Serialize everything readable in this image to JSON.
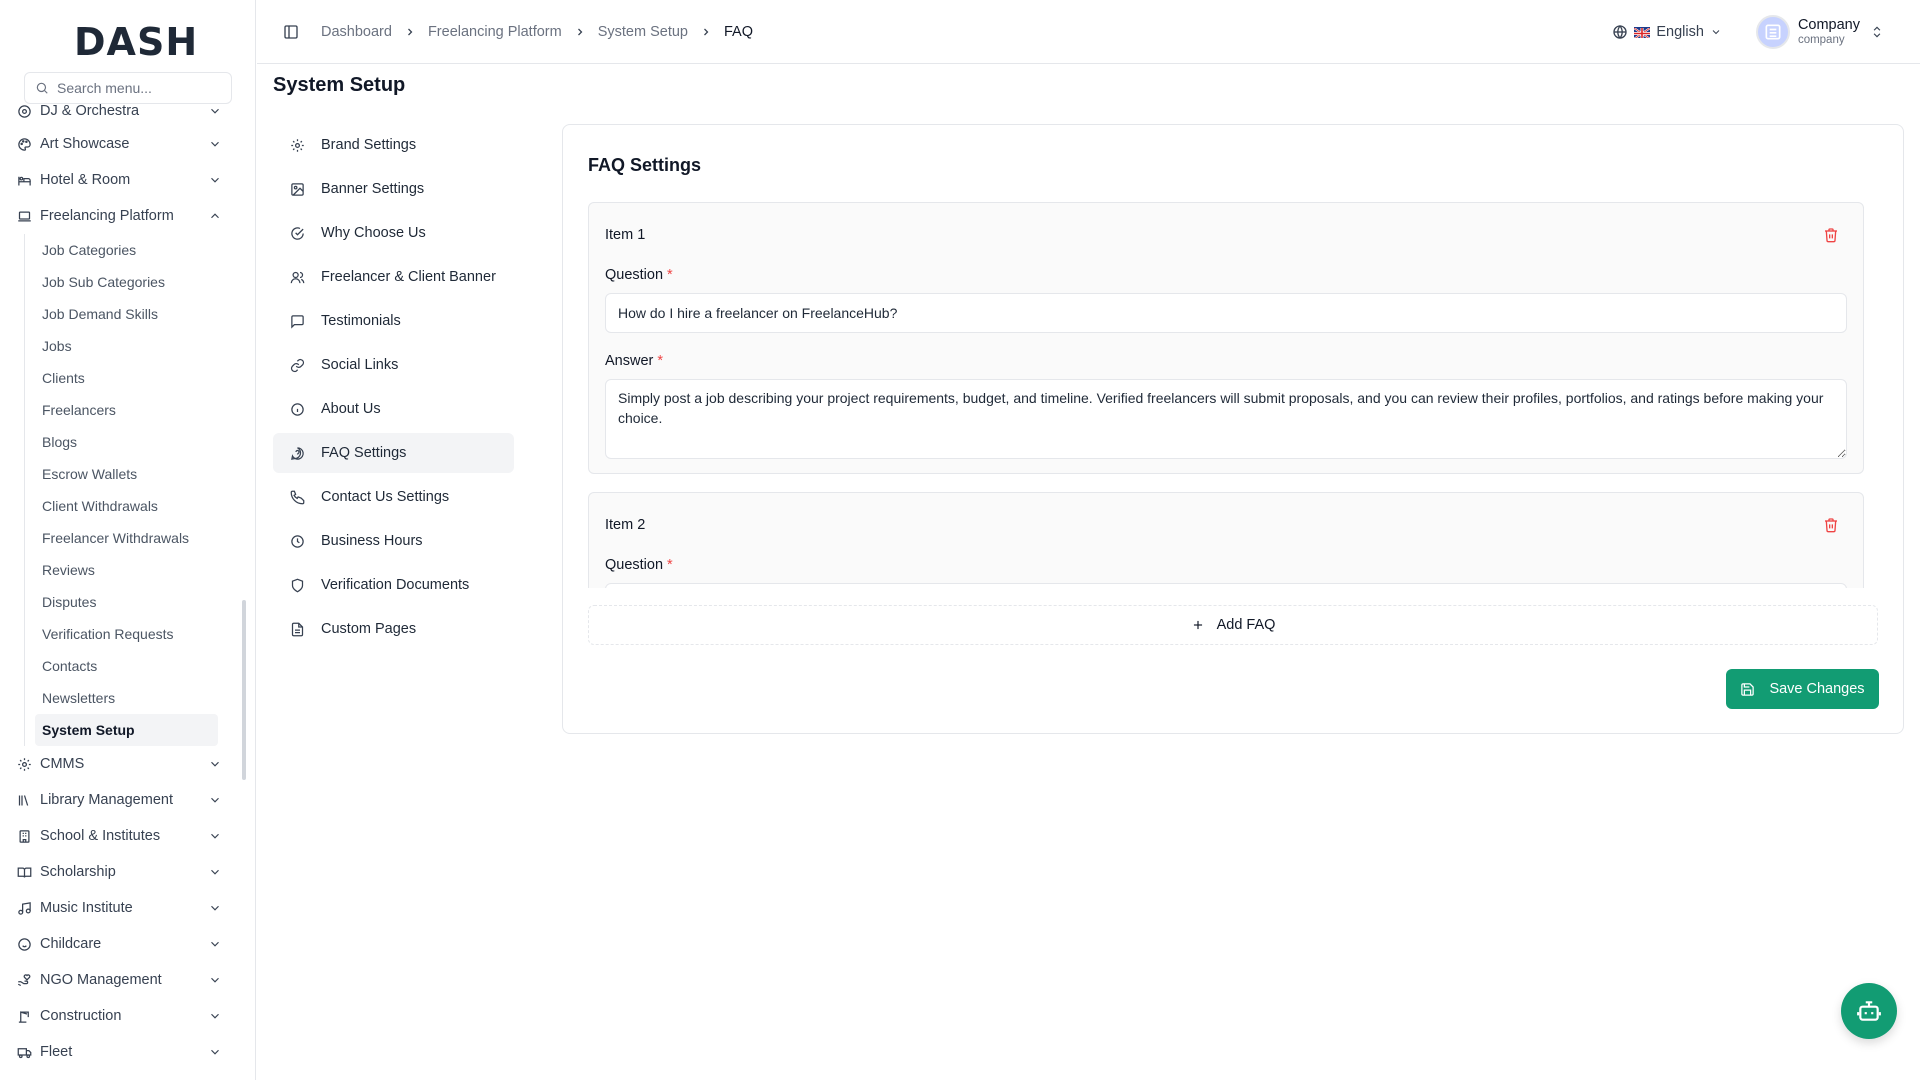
{
  "app": {
    "logo": "DASH",
    "search_placeholder": "Search menu..."
  },
  "sidebar": {
    "top_items": [
      {
        "label": "DJ & Orchestra",
        "icon": "disc-icon"
      },
      {
        "label": "Art Showcase",
        "icon": "palette-icon"
      },
      {
        "label": "Hotel & Room",
        "icon": "hotel-icon"
      },
      {
        "label": "Freelancing Platform",
        "icon": "laptop-icon",
        "expanded": true
      }
    ],
    "sub_items": [
      "Job Categories",
      "Job Sub Categories",
      "Job Demand Skills",
      "Jobs",
      "Clients",
      "Freelancers",
      "Blogs",
      "Escrow Wallets",
      "Client Withdrawals",
      "Freelancer Withdrawals",
      "Reviews",
      "Disputes",
      "Verification Requests",
      "Contacts",
      "Newsletters",
      "System Setup"
    ],
    "active_sub": "System Setup",
    "bottom_items": [
      {
        "label": "CMMS",
        "icon": "gear-icon"
      },
      {
        "label": "Library Management",
        "icon": "library-icon"
      },
      {
        "label": "School & Institutes",
        "icon": "building-icon"
      },
      {
        "label": "Scholarship",
        "icon": "book-open-icon"
      },
      {
        "label": "Music Institute",
        "icon": "music-icon"
      },
      {
        "label": "Childcare",
        "icon": "baby-icon"
      },
      {
        "label": "NGO Management",
        "icon": "hand-heart-icon"
      },
      {
        "label": "Construction",
        "icon": "crane-icon"
      },
      {
        "label": "Fleet",
        "icon": "truck-icon"
      }
    ]
  },
  "header": {
    "breadcrumb": [
      "Dashboard",
      "Freelancing Platform",
      "System Setup",
      "FAQ"
    ],
    "language": "English",
    "user_name": "Company",
    "user_role": "company"
  },
  "page": {
    "title": "System Setup",
    "settings_nav": [
      {
        "label": "Brand Settings",
        "icon": "gear-icon"
      },
      {
        "label": "Banner Settings",
        "icon": "image-icon"
      },
      {
        "label": "Why Choose Us",
        "icon": "check-circle-icon"
      },
      {
        "label": "Freelancer & Client Banner",
        "icon": "users-icon"
      },
      {
        "label": "Testimonials",
        "icon": "message-square-icon"
      },
      {
        "label": "Social Links",
        "icon": "link-icon"
      },
      {
        "label": "About Us",
        "icon": "info-icon"
      },
      {
        "label": "FAQ Settings",
        "icon": "help-circle-icon",
        "active": true
      },
      {
        "label": "Contact Us Settings",
        "icon": "phone-icon"
      },
      {
        "label": "Business Hours",
        "icon": "clock-icon"
      },
      {
        "label": "Verification Documents",
        "icon": "shield-icon"
      },
      {
        "label": "Custom Pages",
        "icon": "file-text-icon"
      }
    ]
  },
  "faq": {
    "card_title": "FAQ Settings",
    "question_label": "Question",
    "answer_label": "Answer",
    "required_mark": "*",
    "items": [
      {
        "title": "Item 1",
        "question": "How do I hire a freelancer on FreelanceHub?",
        "answer": "Simply post a job describing your project requirements, budget, and timeline. Verified freelancers will submit proposals, and you can review their profiles, portfolios, and ratings before making your choice."
      },
      {
        "title": "Item 2",
        "question": "",
        "answer": ""
      }
    ],
    "add_label": "Add FAQ",
    "save_label": "Save Changes"
  },
  "colors": {
    "accent": "#129c73",
    "danger": "#ef4444"
  }
}
